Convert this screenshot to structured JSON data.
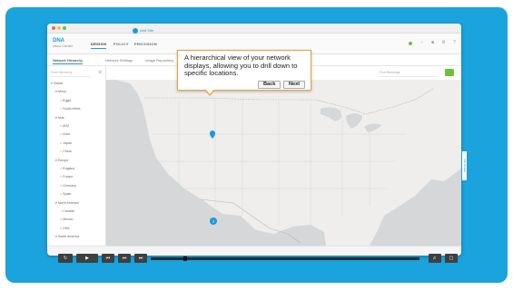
{
  "app": {
    "logo_line1": "DNA",
    "logo_line2": "cisco Center",
    "nav": [
      "DESIGN",
      "POLICY",
      "PROVISION"
    ]
  },
  "subtabs": [
    "Network Hierarchy",
    "Network Settings",
    "Image Repository"
  ],
  "sidebar": {
    "search_placeholder": "Find Hierarchy",
    "tree": [
      {
        "label": "Global",
        "level": 0
      },
      {
        "label": "Africa",
        "level": 1
      },
      {
        "label": "Egypt",
        "level": 2
      },
      {
        "label": "South Africa",
        "level": 2
      },
      {
        "label": "Asia",
        "level": 1
      },
      {
        "label": "ANZ",
        "level": 2
      },
      {
        "label": "India",
        "level": 2
      },
      {
        "label": "Japan",
        "level": 2
      },
      {
        "label": "China",
        "level": 2
      },
      {
        "label": "Europe",
        "level": 1
      },
      {
        "label": "England",
        "level": 2
      },
      {
        "label": "France",
        "level": 2
      },
      {
        "label": "Germany",
        "level": 2
      },
      {
        "label": "Spain",
        "level": 2
      },
      {
        "label": "North America",
        "level": 1
      },
      {
        "label": "Canada",
        "level": 2
      },
      {
        "label": "Mexico",
        "level": 2
      },
      {
        "label": "USA",
        "level": 2
      },
      {
        "label": "South America",
        "level": 1
      }
    ]
  },
  "map": {
    "add_site": "Add Site",
    "search_placeholder": "Find Buildings",
    "side_handle": "Site Details",
    "land_color": "#efeeed",
    "water_color": "#d5d7d8",
    "pin_color": "#1a9bd7",
    "cluster_count": "3"
  },
  "tooltip": {
    "text": "A hierarchical view of your network displays, allowing you to drill down to specific locations.",
    "back_label": "Back",
    "next_label": "Next",
    "border_color": "#e8a23b"
  },
  "player": {
    "progress": 0.13
  },
  "colors": {
    "frame": "#1aa3dc",
    "accent": "#1a9bd7",
    "status_green": "#6fbf3a"
  }
}
